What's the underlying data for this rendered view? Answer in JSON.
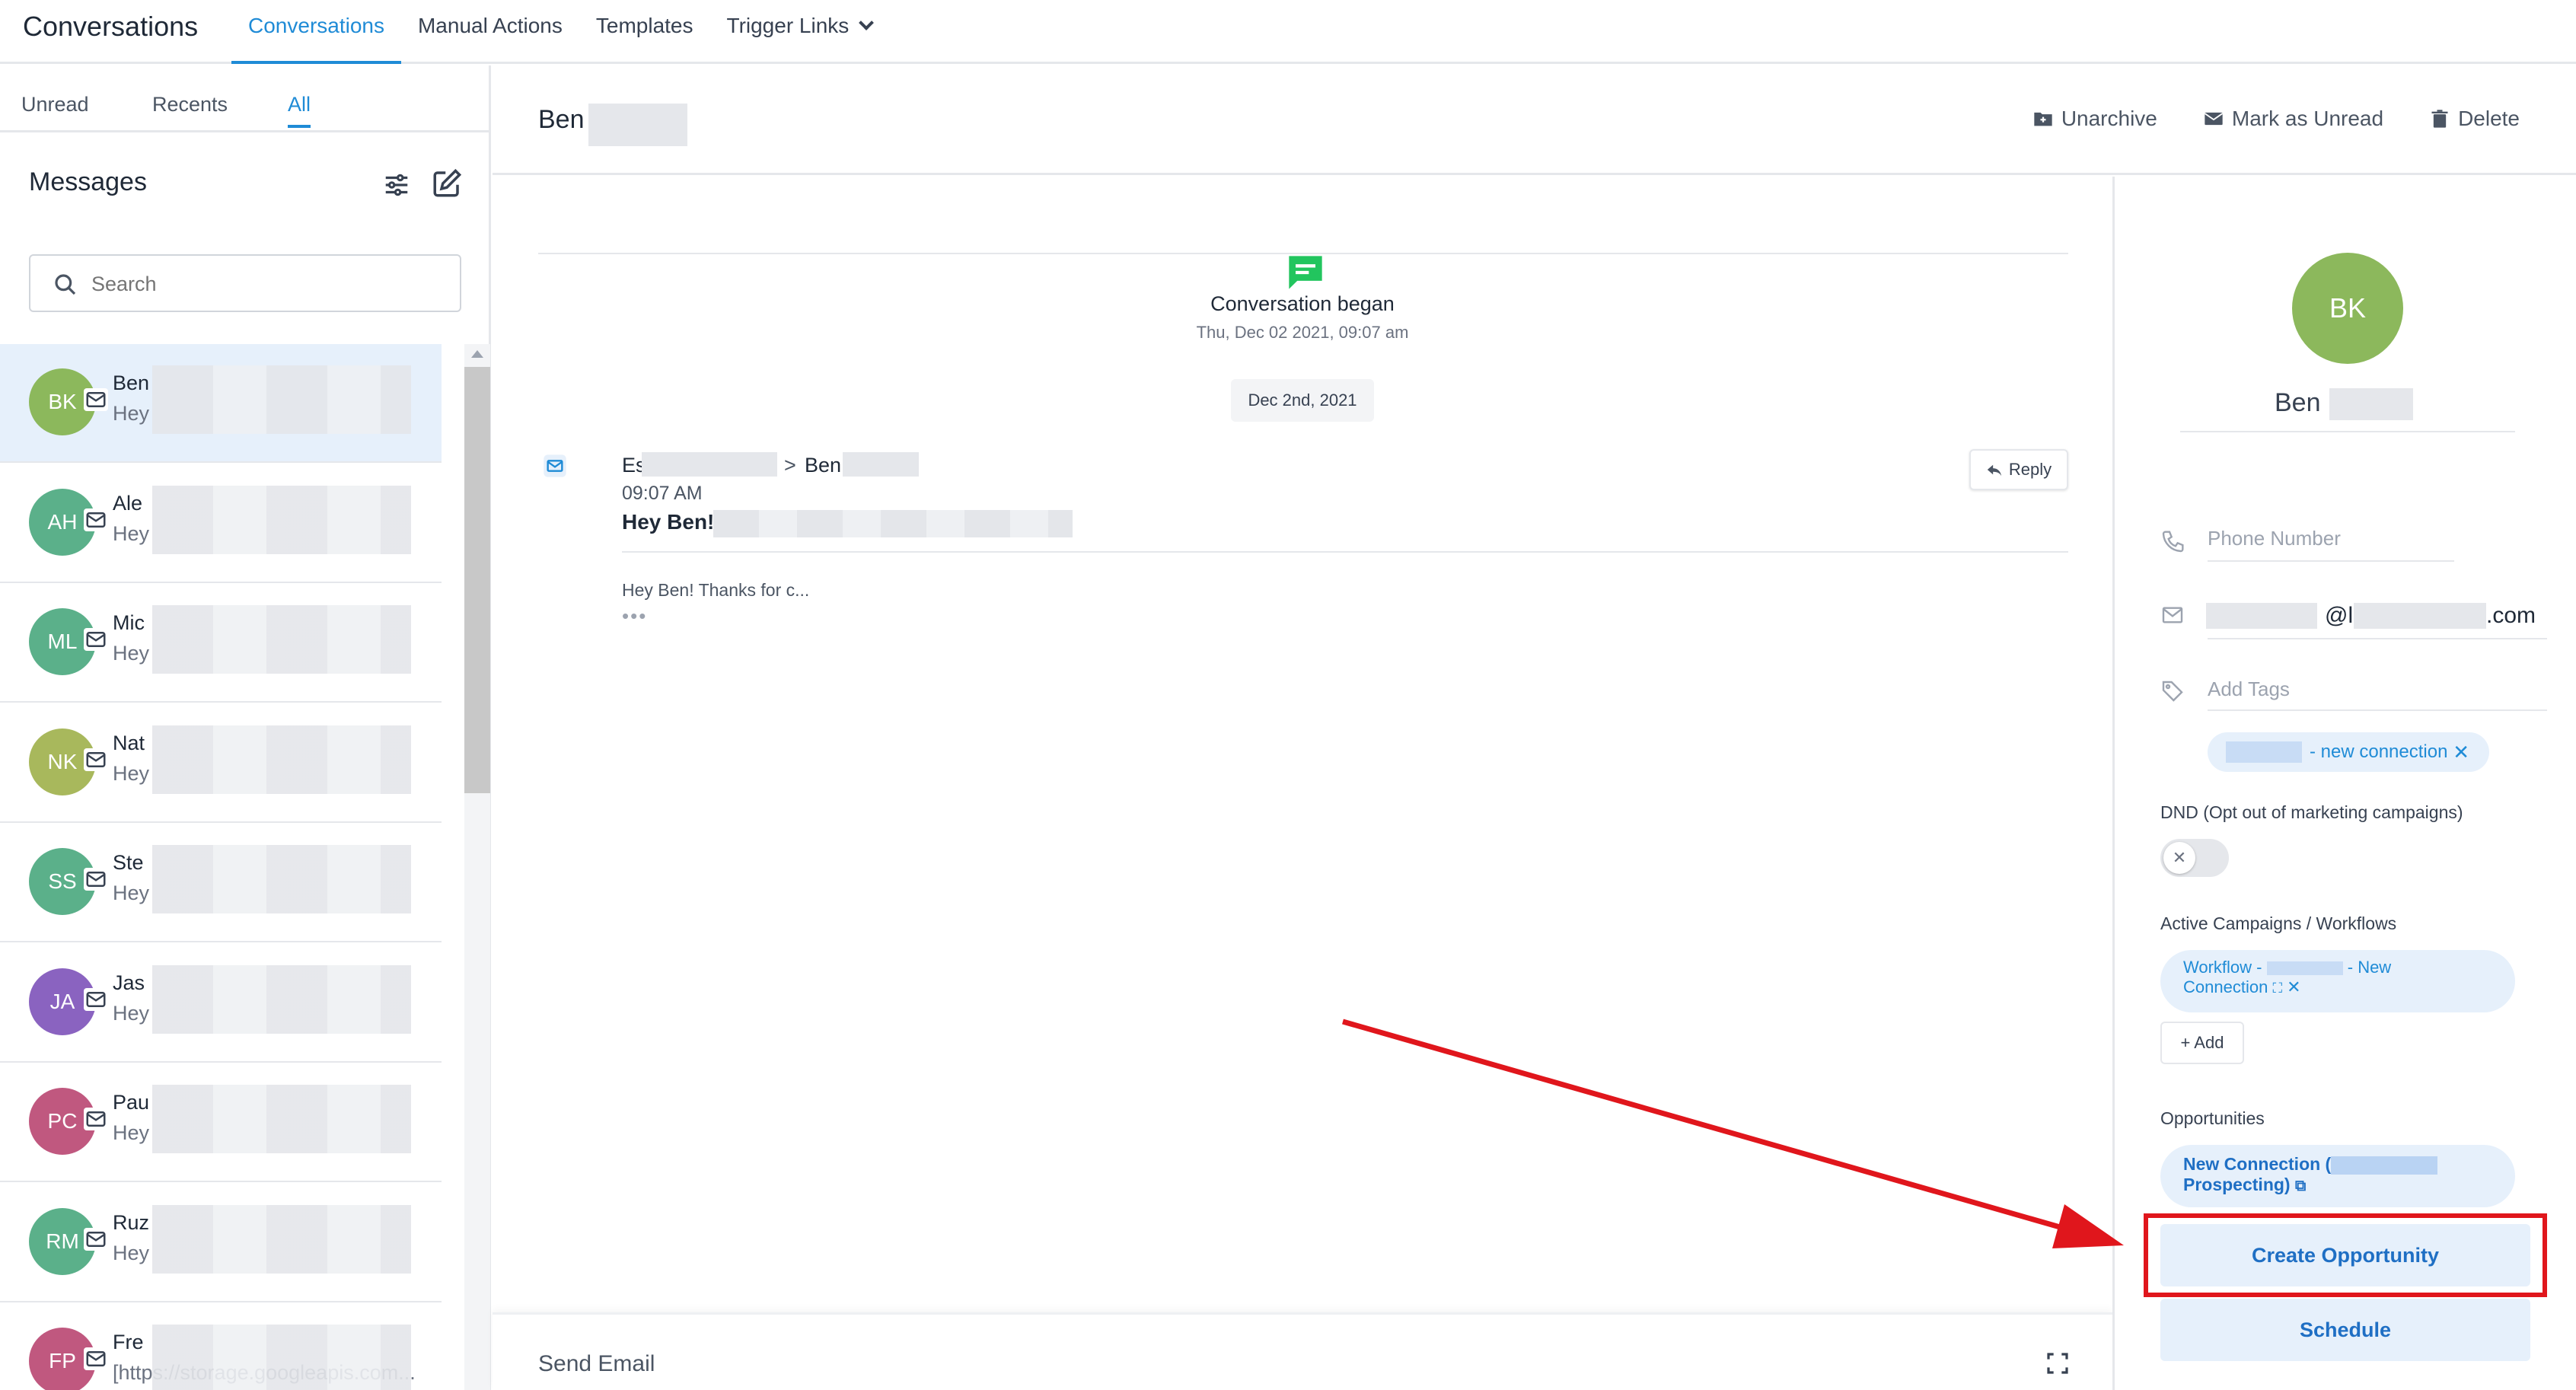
{
  "topbar": {
    "app_title": "Conversations",
    "nav": [
      "Conversations",
      "Manual Actions",
      "Templates",
      "Trigger Links"
    ]
  },
  "left": {
    "tabs": [
      "Unread",
      "Recents",
      "All"
    ],
    "messages_title": "Messages",
    "search_placeholder": "Search",
    "contacts": [
      {
        "initials": "BK",
        "name": "Ben",
        "preview": "Hey",
        "color": "#8cb85c"
      },
      {
        "initials": "AH",
        "name": "Ale",
        "preview": "Hey",
        "color": "#5bb08a"
      },
      {
        "initials": "ML",
        "name": "Mic",
        "preview": "Hey",
        "color": "#5bb08a"
      },
      {
        "initials": "NK",
        "name": "Nat",
        "preview": "Hey",
        "color": "#a8b85c"
      },
      {
        "initials": "SS",
        "name": "Ste",
        "preview": "Hey",
        "color": "#5bb08a"
      },
      {
        "initials": "JA",
        "name": "Jas",
        "preview": "Hey",
        "color": "#8a63c0"
      },
      {
        "initials": "PC",
        "name": "Pau",
        "preview": "Hey",
        "color": "#c0587f"
      },
      {
        "initials": "RM",
        "name": "Ruz",
        "preview": "Hey",
        "color": "#5bb08a"
      },
      {
        "initials": "FP",
        "name": "Fre",
        "preview": "[https://storage.googleapis.com...",
        "color": "#c0587f"
      }
    ]
  },
  "header": {
    "contact_name": "Ben",
    "actions": [
      "Unarchive",
      "Mark as Unread",
      "Delete"
    ]
  },
  "thread": {
    "began_title": "Conversation began",
    "began_time": "Thu, Dec 02 2021, 09:07 am",
    "date_pill": "Dec 2nd, 2021",
    "from_prefix": "Es",
    "arrow": ">",
    "to_name": "Ben",
    "time": "09:07 AM",
    "subject": "Hey Ben!",
    "reply_label": "Reply",
    "body": "Hey Ben! Thanks for c...",
    "more": "•••"
  },
  "composer": {
    "label": "Send Email"
  },
  "right": {
    "initials": "BK",
    "name": "Ben",
    "phone_placeholder": "Phone Number",
    "email_at": "@l",
    "email_tail": ".com",
    "tags_placeholder": "Add Tags",
    "tag_label": "- new connection",
    "tag_remove": "✕",
    "dnd_label": "DND (Opt out of marketing campaigns)",
    "toggle_x": "✕",
    "campaigns_label": "Active Campaigns / Workflows",
    "campaign_prefix": "Workflow -",
    "campaign_suffix": "- New",
    "campaign_line2": "Connection",
    "add_label": "+ Add",
    "opportunities_label": "Opportunities",
    "opp_line1": "New Connection (",
    "opp_line2": "Prospecting)",
    "create_opportunity": "Create Opportunity",
    "schedule": "Schedule"
  }
}
